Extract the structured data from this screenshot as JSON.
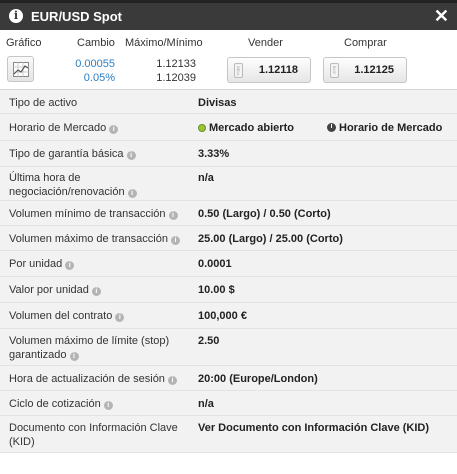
{
  "window": {
    "title": "EUR/USD Spot"
  },
  "quote_header": {
    "chart": "Gráfico",
    "change": "Cambio",
    "highlow": "Máximo/Mínimo",
    "sell": "Vender",
    "buy": "Comprar"
  },
  "quote": {
    "change_abs": "0.00055",
    "change_pct": "0.05%",
    "high": "1.12133",
    "low": "1.12039",
    "sell_tag": "SELL",
    "sell_price": "1.12118",
    "buy_tag": "BUY",
    "buy_price": "1.12125"
  },
  "details": [
    {
      "label": "Tipo de activo",
      "value": "Divisas"
    },
    {
      "label": "Horario de Mercado",
      "value": "Mercado abierto",
      "value2": "Horario de Mercado"
    },
    {
      "label": "Tipo de garantía básica",
      "value": "3.33%"
    },
    {
      "label_line1": "Última hora de",
      "label_line2": "negociación/renovación",
      "value": "n/a"
    },
    {
      "label": "Volumen mínimo de transacción",
      "value": "0.50 (Largo) / 0.50 (Corto)"
    },
    {
      "label": "Volumen máximo de transacción",
      "value": "25.00 (Largo) / 25.00 (Corto)"
    },
    {
      "label": "Por unidad",
      "value": "0.0001"
    },
    {
      "label": "Valor por unidad",
      "value": "10.00 $"
    },
    {
      "label": "Volumen del contrato",
      "value": "100,000 €"
    },
    {
      "label_line1": "Volumen máximo de límite (stop)",
      "label_line2": "garantizado",
      "value": "2.50"
    },
    {
      "label": "Hora de actualización de sesión",
      "value": "20:00 (Europe/London)"
    },
    {
      "label": "Ciclo de cotización",
      "value": "n/a"
    },
    {
      "label_line1": "Documento con Información Clave",
      "label_line2": "(KID)",
      "value": "Ver Documento con Información Clave (KID)"
    }
  ],
  "icons": {
    "info": "i",
    "help": "i",
    "close": "✕"
  },
  "colors": {
    "titlebar": "#3a3a3a",
    "change": "#2a7fc4",
    "market_open": "#9cc43a"
  }
}
